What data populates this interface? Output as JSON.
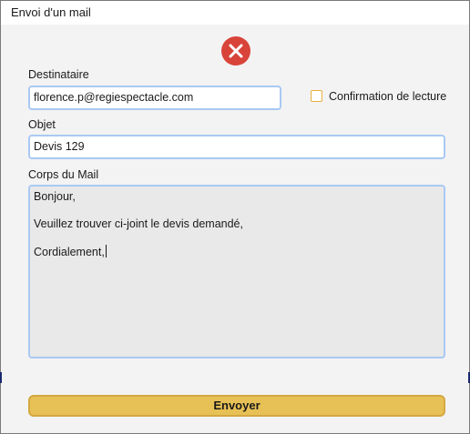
{
  "window": {
    "title": "Envoi d'un mail"
  },
  "form": {
    "recipient_label": "Destinataire",
    "recipient_value": "florence.p@regiespectacle.com",
    "read_receipt_label": "Confirmation de lecture",
    "read_receipt_checked": false,
    "subject_label": "Objet",
    "subject_value": "Devis 129",
    "body_label": "Corps du Mail",
    "body_lines": [
      "Bonjour,",
      "Veuillez trouver ci-joint le devis demandé,",
      "Cordialement,"
    ]
  },
  "actions": {
    "send_label": "Envoyer"
  },
  "icons": {
    "close": "close-circle-icon"
  },
  "colors": {
    "close_icon": "#d9443a",
    "send_button": "#e8c156",
    "field_border": "#a9c9f3",
    "checkbox_border": "#e6b03c"
  }
}
